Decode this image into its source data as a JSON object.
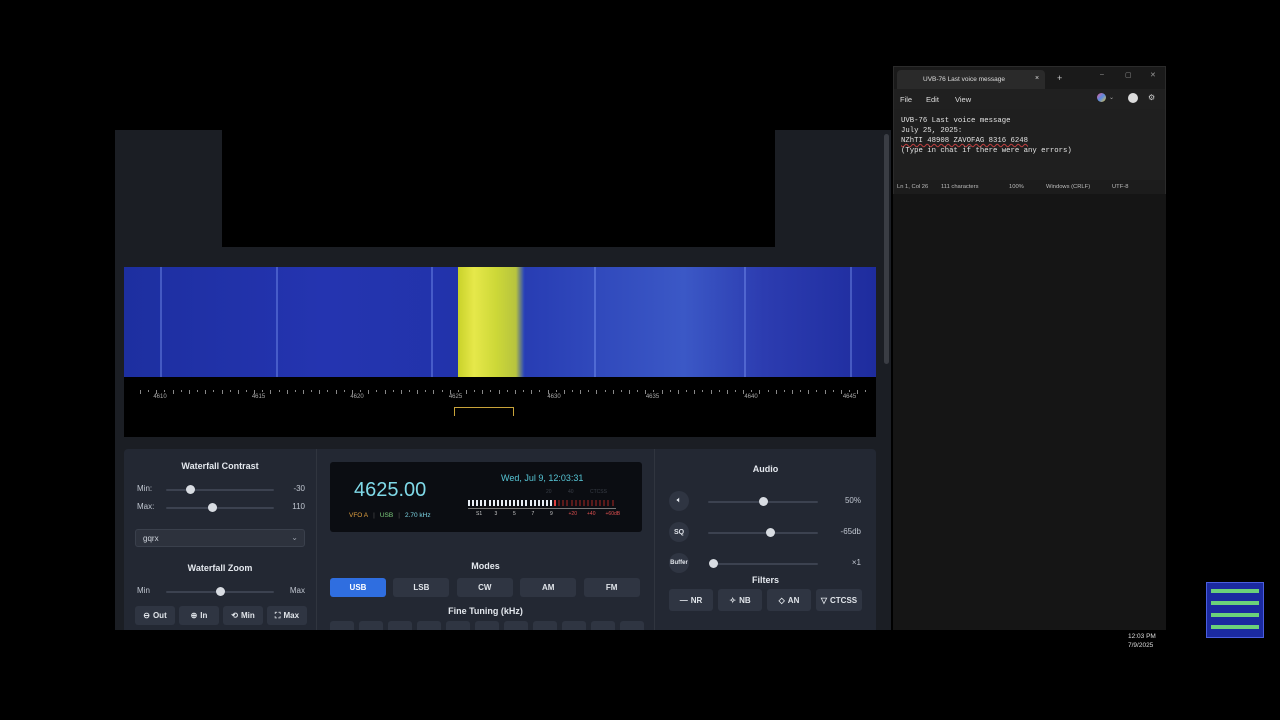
{
  "sdr": {
    "axis_labels": [
      "4610",
      "4615",
      "4620",
      "4625",
      "4630",
      "4635",
      "4640",
      "4645"
    ],
    "waterfall_contrast": {
      "title": "Waterfall Contrast",
      "min_label": "Min:",
      "min_value": "-30",
      "min_level": 0.22,
      "max_label": "Max:",
      "max_value": "110",
      "max_level": 0.43,
      "palette": "gqrx",
      "chevron_icon": "chevron-down-icon"
    },
    "waterfall_zoom": {
      "title": "Waterfall Zoom",
      "min_label": "Min",
      "max_label": "Max",
      "level": 0.5,
      "buttons": [
        {
          "icon": "zoom-out-icon",
          "glyph": "⊖",
          "label": "Out"
        },
        {
          "icon": "zoom-in-icon",
          "glyph": "⊕",
          "label": "In"
        },
        {
          "icon": "minimize-icon",
          "glyph": "⟲",
          "label": "Min"
        },
        {
          "icon": "maximize-icon",
          "glyph": "⛶",
          "label": "Max"
        }
      ]
    },
    "display": {
      "frequency": "4625.00",
      "vfo": "VFO A",
      "mode": "USB",
      "bandwidth": "2.70 kHz",
      "datetime": "Wed, Jul 9, 12:03:31",
      "meter_scale": [
        "S1",
        "3",
        "5",
        "7",
        "9",
        "+20",
        "+40",
        "+60dB"
      ],
      "meter_top": [
        "20",
        "40",
        "CTCSS"
      ],
      "signal_level": 0.62
    },
    "modes": {
      "title": "Modes",
      "items": [
        "USB",
        "LSB",
        "CW",
        "AM",
        "FM"
      ],
      "active": "USB"
    },
    "fine_tuning": {
      "title": "Fine Tuning (kHz)"
    },
    "audio": {
      "title": "Audio",
      "volume_icon": "speaker-icon",
      "volume_value": "50%",
      "volume_level": 0.5,
      "squelch_label": "SQ",
      "squelch_value": "-65db",
      "squelch_level": 0.56,
      "buffer_label": "Buffer",
      "buffer_value": "×1",
      "buffer_level": 0.0
    },
    "filters": {
      "title": "Filters",
      "items": [
        {
          "icon": "minus-icon",
          "glyph": "—",
          "label": "NR"
        },
        {
          "icon": "sparkle-icon",
          "glyph": "✧",
          "label": "NB"
        },
        {
          "icon": "shield-icon",
          "glyph": "◇",
          "label": "AN"
        },
        {
          "icon": "filter-icon",
          "glyph": "▽",
          "label": "CTCSS"
        }
      ]
    }
  },
  "notepad": {
    "tab_title": "UVB-76 Last voice message",
    "tab_close": "×",
    "new_tab": "+",
    "menu": [
      "File",
      "Edit",
      "View"
    ],
    "content_lines": [
      "UVB-76 Last voice message",
      "July 25, 2025:",
      "NZhTI 48908 ZAVOFAG 8316 6248",
      "(Type in chat if there were any errors)"
    ],
    "status": {
      "position": "Ln 1, Col 26",
      "chars": "111 characters",
      "zoom": "100%",
      "line_endings": "Windows (CRLF)",
      "encoding": "UTF-8"
    },
    "window_controls": [
      "–",
      "▢",
      "✕"
    ]
  },
  "taskbar": {
    "time": "12:03 PM",
    "date": "7/9/2025"
  }
}
